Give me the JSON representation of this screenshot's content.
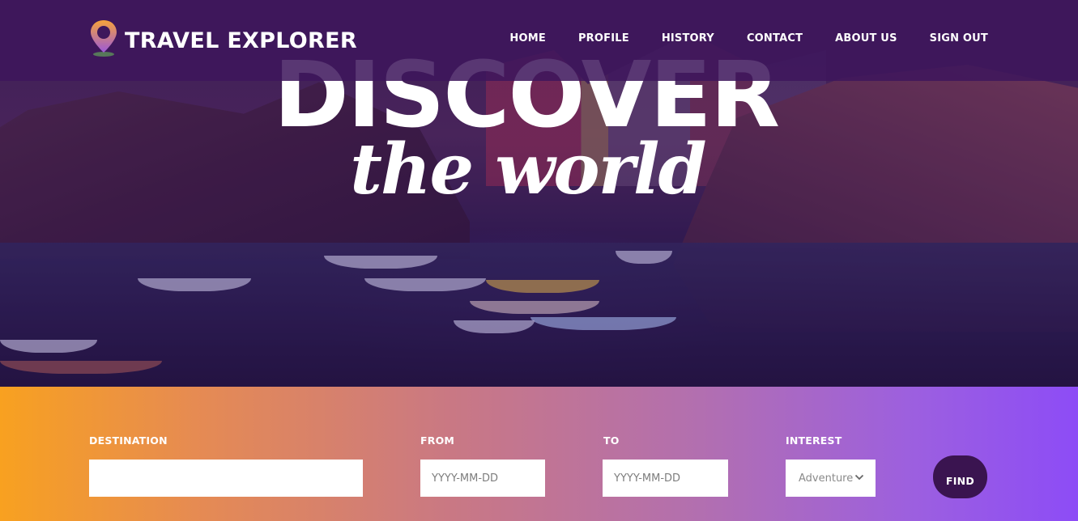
{
  "brand": {
    "name": "TRAVEL EXPLORER",
    "icon": "map-pin-icon"
  },
  "nav": {
    "items": [
      {
        "label": "HOME"
      },
      {
        "label": "PROFILE"
      },
      {
        "label": "HISTORY"
      },
      {
        "label": "CONTACT"
      },
      {
        "label": "ABOUT US"
      },
      {
        "label": "SIGN OUT"
      }
    ]
  },
  "hero": {
    "headline": "DISCOVER",
    "tagline": "the world"
  },
  "search": {
    "destination": {
      "label": "DESTINATION",
      "value": "",
      "placeholder": ""
    },
    "from": {
      "label": "FROM",
      "placeholder": "YYYY-MM-DD"
    },
    "to": {
      "label": "TO",
      "placeholder": "YYYY-MM-DD"
    },
    "interest": {
      "label": "INTEREST",
      "selected": "Adventure",
      "icon": "chevron-down-icon"
    },
    "submit_label": "FIND"
  },
  "colors": {
    "navbar": "#3e165c",
    "gradient_start": "#f8a120",
    "gradient_end": "#8d4cf6",
    "button": "#3a1450",
    "pin_top": "#f6a23a",
    "pin_bottom": "#9b59d9"
  }
}
